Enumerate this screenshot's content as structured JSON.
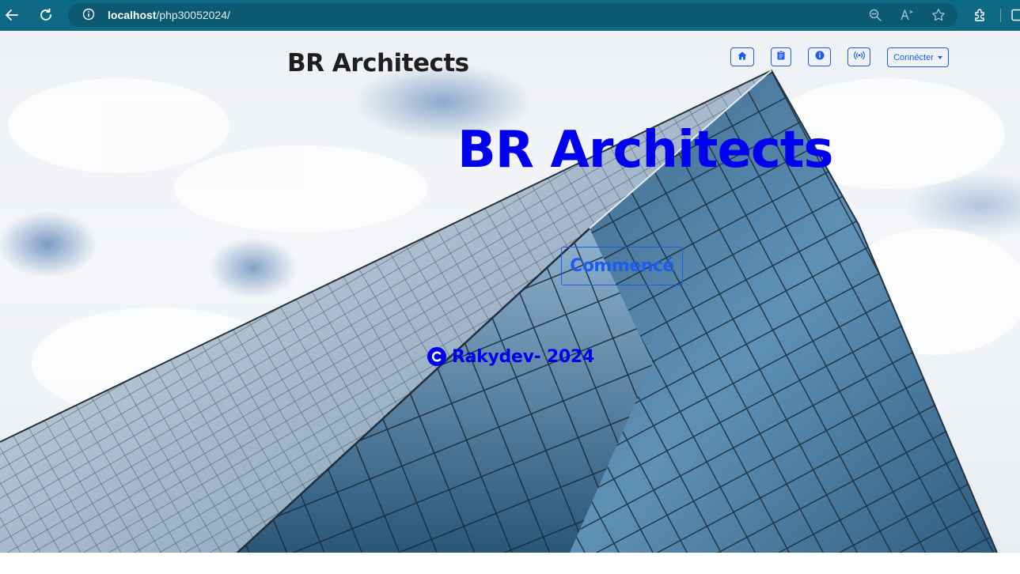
{
  "browser": {
    "url_host": "localhost",
    "url_path": "/php30052024/",
    "icons": {
      "back": "back-arrow-icon",
      "reload": "reload-icon",
      "info": "info-icon",
      "zoom": "zoom-out-icon",
      "read_aloud": "read-aloud-icon",
      "favorite": "favorite-star-icon",
      "extensions": "extensions-icon",
      "split": "split-screen-icon"
    },
    "colors": {
      "toolbar": "#0e6a84",
      "address_bar": "#0b5a72"
    }
  },
  "header": {
    "brand": "BR Architects",
    "nav_icons": [
      "home-icon",
      "clipboard-icon",
      "info-circle-icon",
      "broadcast-icon"
    ],
    "dropdown_label": "Connécter"
  },
  "hero": {
    "title": "BR Architects",
    "cta_label": "Commencé"
  },
  "footer": {
    "copyright_icon": "copyright-icon",
    "text": "Rakydev- 2024"
  },
  "colors": {
    "accent": "#1e5bf0",
    "hero_text": "#0000ee",
    "brand_text": "#1f1f1f"
  }
}
